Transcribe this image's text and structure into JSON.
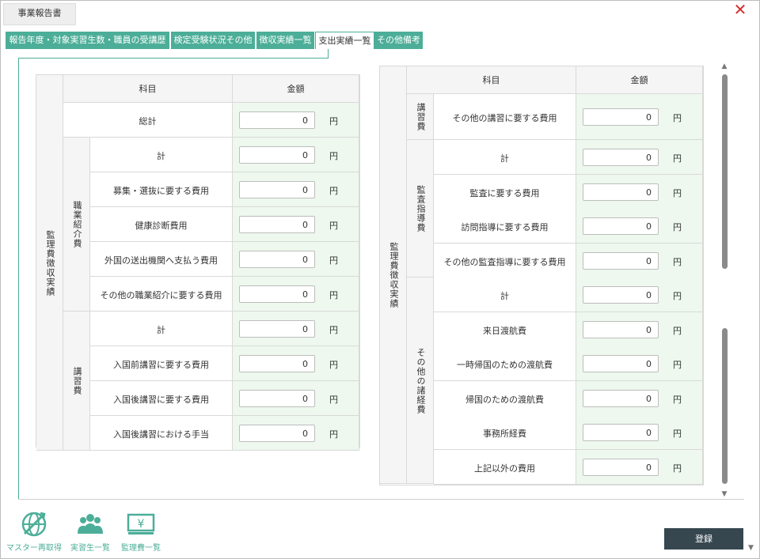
{
  "window": {
    "title": "事業報告書",
    "close_icon": "close-icon"
  },
  "tabs": [
    {
      "label": "報告年度・対象実習生数・職員の受講歴",
      "active": false
    },
    {
      "label": "検定受験状況その他",
      "active": false
    },
    {
      "label": "徴収実績一覧",
      "active": false
    },
    {
      "label": "支出実績一覧",
      "active": true
    },
    {
      "label": "その他備考",
      "active": false
    }
  ],
  "left_table": {
    "header": {
      "subject": "科目",
      "amount": "金額"
    },
    "group": "監理費徴収実績",
    "total_label": "総計",
    "total_value": "0",
    "sections": [
      {
        "name": "職業紹介費",
        "rows": [
          {
            "label": "計",
            "value": "0"
          },
          {
            "label": "募集・選抜に要する費用",
            "value": "0"
          },
          {
            "label": "健康診断費用",
            "value": "0"
          },
          {
            "label": "外国の送出機関へ支払う費用",
            "value": "0"
          },
          {
            "label": "その他の職業紹介に要する費用",
            "value": "0"
          }
        ]
      },
      {
        "name": "講習費",
        "rows": [
          {
            "label": "計",
            "value": "0"
          },
          {
            "label": "入国前講習に要する費用",
            "value": "0"
          },
          {
            "label": "入国後講習に要する費用",
            "value": "0"
          },
          {
            "label": "入国後講習における手当",
            "value": "0"
          }
        ]
      }
    ]
  },
  "right_table": {
    "header": {
      "subject": "科目",
      "amount": "金額"
    },
    "group": "監理費徴収実績",
    "sections": [
      {
        "name": "講習費",
        "rows": [
          {
            "label": "その他の講習に要する費用",
            "value": "0"
          }
        ]
      },
      {
        "name": "監査指導費",
        "rows": [
          {
            "label": "計",
            "value": "0"
          },
          {
            "label": "監査に要する費用",
            "value": "0"
          },
          {
            "label": "訪問指導に要する費用",
            "value": "0"
          },
          {
            "label": "その他の監査指導に要する費用",
            "value": "0"
          }
        ]
      },
      {
        "name": "その他の諸経費",
        "rows": [
          {
            "label": "計",
            "value": "0"
          },
          {
            "label": "来日渡航費",
            "value": "0"
          },
          {
            "label": "一時帰国のための渡航費",
            "value": "0"
          },
          {
            "label": "帰国のための渡航費",
            "value": "0"
          },
          {
            "label": "事務所経費",
            "value": "0"
          },
          {
            "label": "上記以外の費用",
            "value": "0"
          }
        ]
      }
    ]
  },
  "unit": "円",
  "scrollbar": {
    "up_icon": "▲",
    "down_icon": "▼"
  },
  "bottom_buttons": [
    {
      "label": "マスター再取得",
      "icon": "globe-refresh-icon"
    },
    {
      "label": "実習生一覧",
      "icon": "people-group-icon"
    },
    {
      "label": "監理費一覧",
      "icon": "yen-bill-icon"
    }
  ],
  "save_label": "登録",
  "colors": {
    "accent": "#4cae98",
    "amount_bg": "#eef8ee",
    "header_bg": "#f5f5f5",
    "save_bg": "#37474f",
    "close": "#d32f2f"
  }
}
